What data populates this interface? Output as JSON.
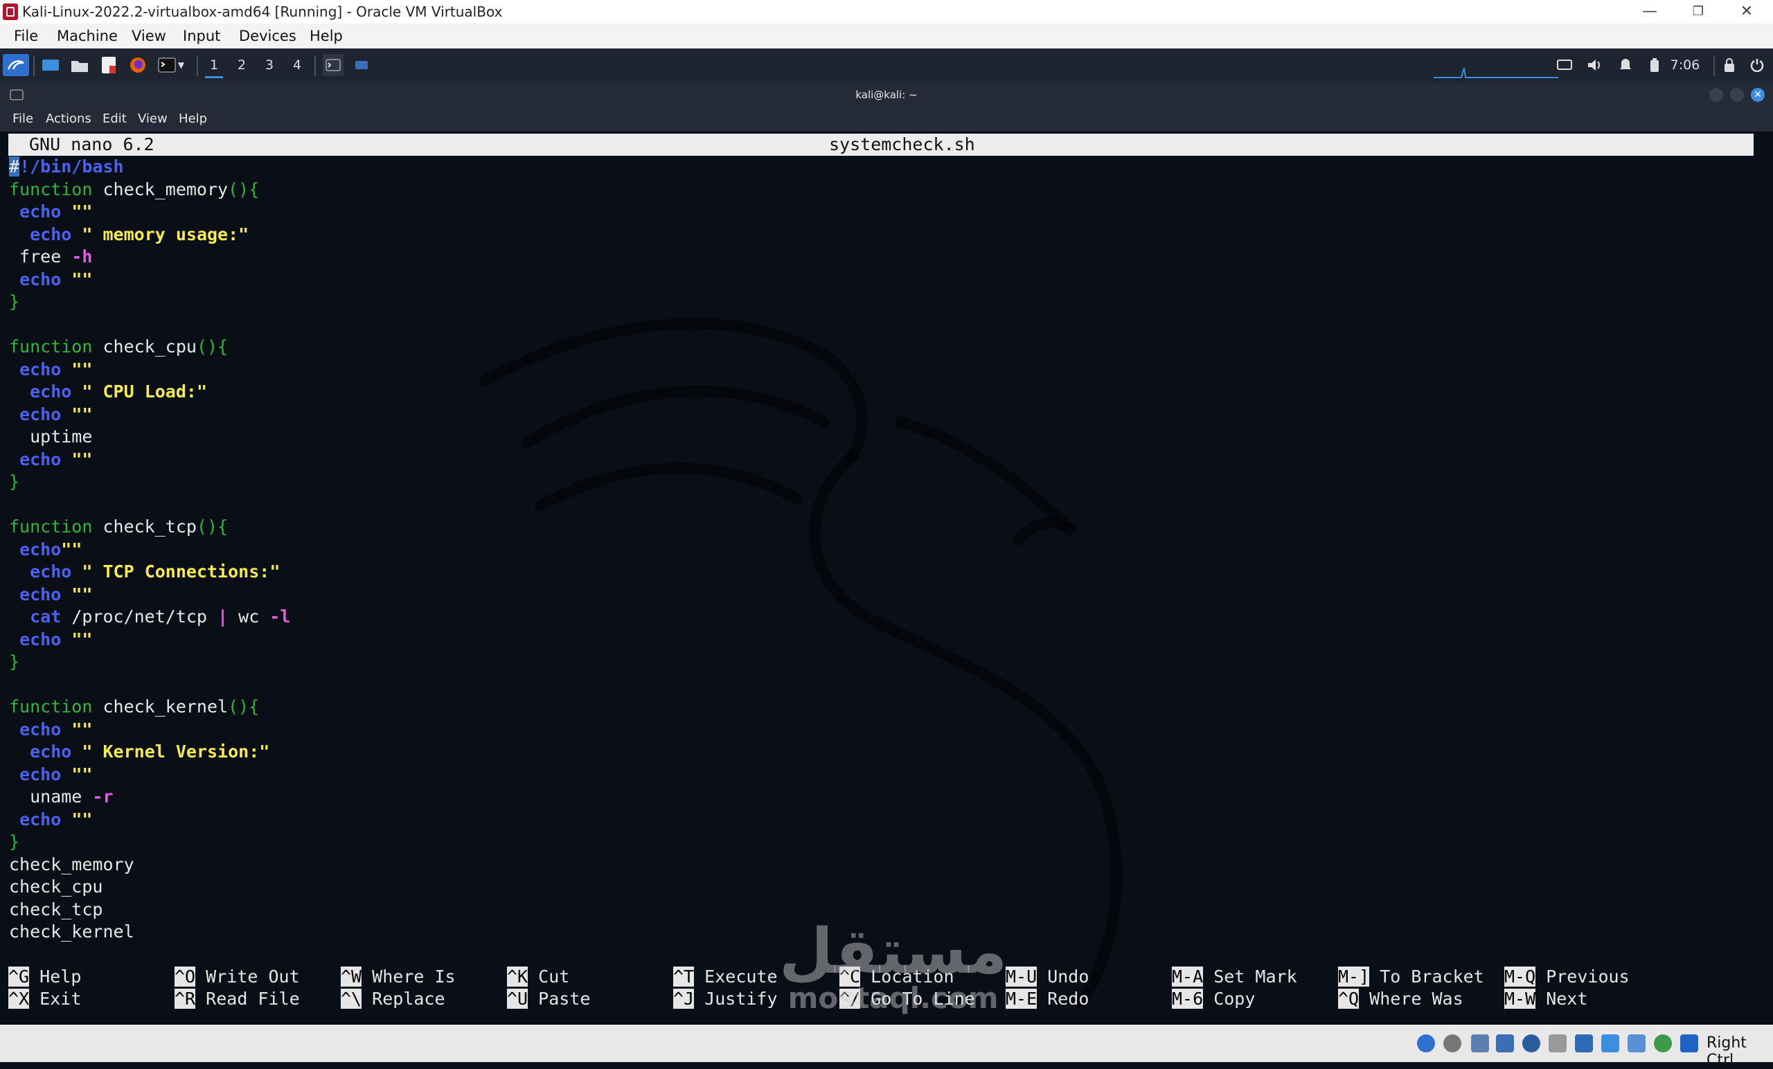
{
  "host": {
    "window_title": "Kali-Linux-2022.2-virtualbox-amd64 [Running] - Oracle VM VirtualBox",
    "controls": {
      "minimize": "—",
      "restore": "❐",
      "close": "✕"
    },
    "menu": [
      "File",
      "Machine",
      "View",
      "Input",
      "Devices",
      "Help"
    ],
    "status_right": "Right Ctrl"
  },
  "kali_panel": {
    "workspaces": [
      "1",
      "2",
      "3",
      "4"
    ],
    "clock": "7:06"
  },
  "terminal": {
    "title": "kali@kali: ~",
    "menu": [
      "File",
      "Actions",
      "Edit",
      "View",
      "Help"
    ]
  },
  "nano": {
    "version": "GNU nano 6.2",
    "filename": "systemcheck.sh",
    "help": [
      {
        "key": "^G",
        "label": "Help"
      },
      {
        "key": "^X",
        "label": "Exit"
      },
      {
        "key": "^O",
        "label": "Write Out"
      },
      {
        "key": "^R",
        "label": "Read File"
      },
      {
        "key": "^W",
        "label": "Where Is"
      },
      {
        "key": "^\\",
        "label": "Replace"
      },
      {
        "key": "^K",
        "label": "Cut"
      },
      {
        "key": "^U",
        "label": "Paste"
      },
      {
        "key": "^T",
        "label": "Execute"
      },
      {
        "key": "^J",
        "label": "Justify"
      },
      {
        "key": "^C",
        "label": "Location"
      },
      {
        "key": "^/",
        "label": "Go To Line"
      },
      {
        "key": "M-U",
        "label": "Undo"
      },
      {
        "key": "M-E",
        "label": "Redo"
      },
      {
        "key": "M-A",
        "label": "Set Mark"
      },
      {
        "key": "M-6",
        "label": "Copy"
      },
      {
        "key": "M-]",
        "label": "To Bracket"
      },
      {
        "key": "^Q",
        "label": "Where Was"
      },
      {
        "key": "M-Q",
        "label": "Previous"
      },
      {
        "key": "M-W",
        "label": "Next"
      }
    ]
  },
  "code_lines": [
    [
      {
        "c": "cur",
        "t": "#"
      },
      {
        "c": "ec",
        "t": "!/bin/bash"
      }
    ],
    [
      {
        "c": "kw",
        "t": "function"
      },
      {
        "c": "",
        "t": " check_memory"
      },
      {
        "c": "br",
        "t": "(){"
      }
    ],
    [
      {
        "c": "",
        "t": " "
      },
      {
        "c": "ec",
        "t": "echo"
      },
      {
        "c": "",
        "t": " "
      },
      {
        "c": "st",
        "t": "\"\""
      }
    ],
    [
      {
        "c": "",
        "t": "  "
      },
      {
        "c": "ec",
        "t": "echo"
      },
      {
        "c": "",
        "t": " "
      },
      {
        "c": "st",
        "t": "\" memory usage:\""
      }
    ],
    [
      {
        "c": "",
        "t": " free "
      },
      {
        "c": "op",
        "t": "-h"
      }
    ],
    [
      {
        "c": "",
        "t": " "
      },
      {
        "c": "ec",
        "t": "echo"
      },
      {
        "c": "",
        "t": " "
      },
      {
        "c": "st",
        "t": "\"\""
      }
    ],
    [
      {
        "c": "br",
        "t": "}"
      }
    ],
    [
      {
        "c": "",
        "t": ""
      }
    ],
    [
      {
        "c": "kw",
        "t": "function"
      },
      {
        "c": "",
        "t": " check_cpu"
      },
      {
        "c": "br",
        "t": "(){"
      }
    ],
    [
      {
        "c": "",
        "t": " "
      },
      {
        "c": "ec",
        "t": "echo"
      },
      {
        "c": "",
        "t": " "
      },
      {
        "c": "st",
        "t": "\"\""
      }
    ],
    [
      {
        "c": "",
        "t": "  "
      },
      {
        "c": "ec",
        "t": "echo"
      },
      {
        "c": "",
        "t": " "
      },
      {
        "c": "st",
        "t": "\" CPU Load:\""
      }
    ],
    [
      {
        "c": "",
        "t": " "
      },
      {
        "c": "ec",
        "t": "echo"
      },
      {
        "c": "",
        "t": " "
      },
      {
        "c": "st",
        "t": "\"\""
      }
    ],
    [
      {
        "c": "",
        "t": "  uptime"
      }
    ],
    [
      {
        "c": "",
        "t": " "
      },
      {
        "c": "ec",
        "t": "echo"
      },
      {
        "c": "",
        "t": " "
      },
      {
        "c": "st",
        "t": "\"\""
      }
    ],
    [
      {
        "c": "br",
        "t": "}"
      }
    ],
    [
      {
        "c": "",
        "t": ""
      }
    ],
    [
      {
        "c": "kw",
        "t": "function"
      },
      {
        "c": "",
        "t": " check_tcp"
      },
      {
        "c": "br",
        "t": "(){"
      }
    ],
    [
      {
        "c": "",
        "t": " "
      },
      {
        "c": "ec",
        "t": "echo"
      },
      {
        "c": "st",
        "t": "\"\""
      }
    ],
    [
      {
        "c": "",
        "t": "  "
      },
      {
        "c": "ec",
        "t": "echo"
      },
      {
        "c": "",
        "t": " "
      },
      {
        "c": "st",
        "t": "\" TCP Connections:\""
      }
    ],
    [
      {
        "c": "",
        "t": " "
      },
      {
        "c": "ec",
        "t": "echo"
      },
      {
        "c": "",
        "t": " "
      },
      {
        "c": "st",
        "t": "\"\""
      }
    ],
    [
      {
        "c": "",
        "t": "  "
      },
      {
        "c": "ec",
        "t": "cat"
      },
      {
        "c": "",
        "t": " /proc/net/tcp "
      },
      {
        "c": "op",
        "t": "|"
      },
      {
        "c": "",
        "t": " wc "
      },
      {
        "c": "op",
        "t": "-l"
      }
    ],
    [
      {
        "c": "",
        "t": " "
      },
      {
        "c": "ec",
        "t": "echo"
      },
      {
        "c": "",
        "t": " "
      },
      {
        "c": "st",
        "t": "\"\""
      }
    ],
    [
      {
        "c": "br",
        "t": "}"
      }
    ],
    [
      {
        "c": "",
        "t": ""
      }
    ],
    [
      {
        "c": "kw",
        "t": "function"
      },
      {
        "c": "",
        "t": " check_kernel"
      },
      {
        "c": "br",
        "t": "(){"
      }
    ],
    [
      {
        "c": "",
        "t": " "
      },
      {
        "c": "ec",
        "t": "echo"
      },
      {
        "c": "",
        "t": " "
      },
      {
        "c": "st",
        "t": "\"\""
      }
    ],
    [
      {
        "c": "",
        "t": "  "
      },
      {
        "c": "ec",
        "t": "echo"
      },
      {
        "c": "",
        "t": " "
      },
      {
        "c": "st",
        "t": "\" Kernel Version:\""
      }
    ],
    [
      {
        "c": "",
        "t": " "
      },
      {
        "c": "ec",
        "t": "echo"
      },
      {
        "c": "",
        "t": " "
      },
      {
        "c": "st",
        "t": "\"\""
      }
    ],
    [
      {
        "c": "",
        "t": "  uname "
      },
      {
        "c": "op",
        "t": "-r"
      }
    ],
    [
      {
        "c": "",
        "t": " "
      },
      {
        "c": "ec",
        "t": "echo"
      },
      {
        "c": "",
        "t": " "
      },
      {
        "c": "st",
        "t": "\"\""
      }
    ],
    [
      {
        "c": "br",
        "t": "}"
      }
    ],
    [
      {
        "c": "",
        "t": "check_memory"
      }
    ],
    [
      {
        "c": "",
        "t": "check_cpu"
      }
    ],
    [
      {
        "c": "",
        "t": "check_tcp"
      }
    ],
    [
      {
        "c": "",
        "t": "check_kernel"
      }
    ]
  ],
  "watermark": {
    "arabic": "مستقل",
    "latin": "mostaql.com"
  },
  "colors": {
    "keyword": "#2eb83a",
    "builtin": "#4a62f0",
    "string": "#f7ec4e",
    "option": "#e05ce0",
    "background": "#0a0e16",
    "panel": "#1e2430",
    "accent": "#3b8ee0"
  }
}
